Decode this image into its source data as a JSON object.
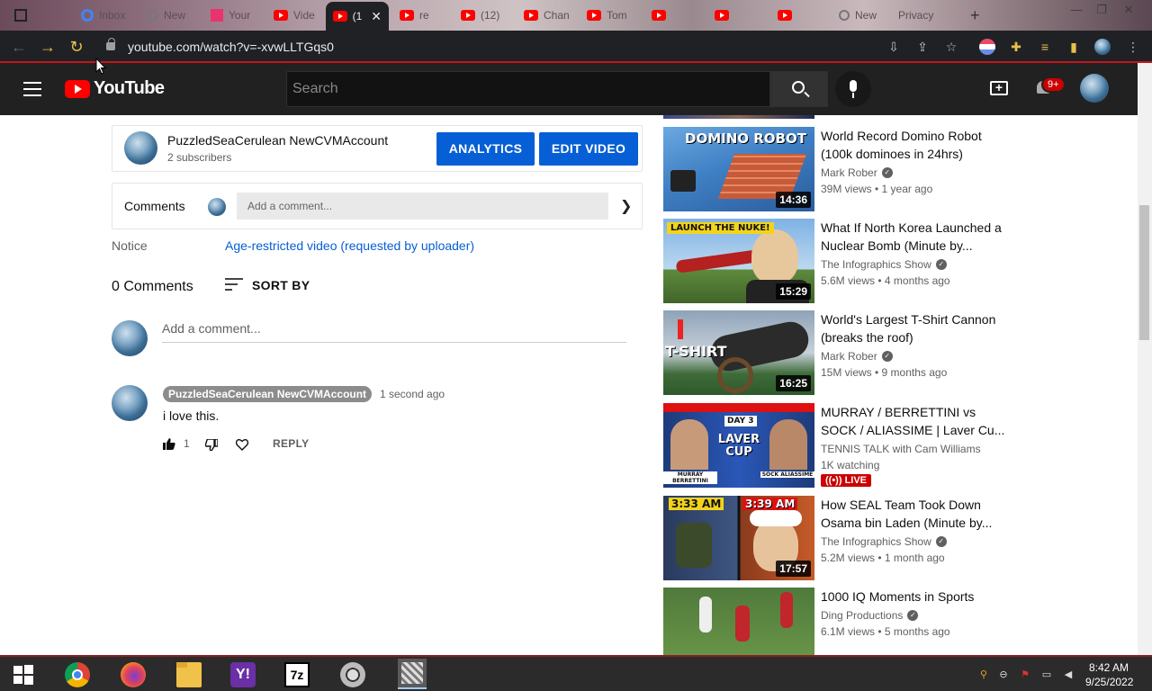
{
  "browser": {
    "url": "youtube.com/watch?v=-xvwLLTGqs0",
    "tabs": [
      {
        "label": "Inbox"
      },
      {
        "label": "New"
      },
      {
        "label": "Your"
      },
      {
        "label": "Vide"
      },
      {
        "label": "(1",
        "active": true
      },
      {
        "label": "re"
      },
      {
        "label": "(12)"
      },
      {
        "label": "Chan"
      },
      {
        "label": "Tom"
      },
      {
        "label": "New"
      },
      {
        "label": "Privacy"
      }
    ]
  },
  "header": {
    "logo_text": "YouTube",
    "search_placeholder": "Search",
    "notification_count": "9+"
  },
  "channel": {
    "name": "PuzzledSeaCerulean NewCVMAccount",
    "subscribers": "2 subscribers",
    "analytics_label": "ANALYTICS",
    "edit_label": "EDIT VIDEO"
  },
  "comments_panel": {
    "label": "Comments",
    "placeholder": "Add a comment..."
  },
  "notice": {
    "label": "Notice",
    "text": "Age-restricted video (requested by uploader)"
  },
  "comments": {
    "count_label": "0 Comments",
    "sort_label": "SORT BY",
    "add_placeholder": "Add a comment...",
    "items": [
      {
        "author": "PuzzledSeaCerulean NewCVMAccount",
        "time": "1 second ago",
        "text": "i love this.",
        "likes": "1",
        "reply_label": "REPLY"
      }
    ]
  },
  "recommendations": [
    {
      "title": "World Record Domino Robot (100k dominoes in 24hrs)",
      "channel": "Mark Rober",
      "meta": "39M views • 1 year ago",
      "duration": "14:36",
      "thumb_text": "DOMINO ROBOT",
      "verified": true
    },
    {
      "title": "What If North Korea Launched a Nuclear Bomb (Minute by...",
      "channel": "The Infographics Show",
      "meta": "5.6M views • 4 months ago",
      "duration": "15:29",
      "thumb_text": "LAUNCH THE NUKE!",
      "verified": true
    },
    {
      "title": "World's Largest T-Shirt Cannon (breaks the roof)",
      "channel": "Mark Rober",
      "meta": "15M views • 9 months ago",
      "duration": "16:25",
      "thumb_text": "T-SHIRT",
      "verified": true
    },
    {
      "title": "MURRAY / BERRETTINI vs SOCK / ALIASSIME | Laver Cu...",
      "channel": "TENNIS TALK with Cam Williams",
      "meta": "1K watching",
      "live_label": "LIVE",
      "thumb_text": "LAVER CUP",
      "thumb_day": "DAY 3",
      "thumb_left": "MURRAY BERRETTINI",
      "thumb_right": "SOCK ALIASSIME",
      "verified": false
    },
    {
      "title": "How SEAL Team Took Down Osama bin Laden (Minute by...",
      "channel": "The Infographics Show",
      "meta": "5.2M views • 1 month ago",
      "duration": "17:57",
      "thumb_text_left": "3:33 AM",
      "thumb_text_right": "3:39 AM",
      "verified": true
    },
    {
      "title": "1000 IQ Moments in Sports",
      "channel": "Ding Productions",
      "meta": "6.1M views • 5 months ago",
      "verified": true
    }
  ],
  "taskbar": {
    "time": "8:42 AM",
    "date": "9/25/2022"
  },
  "colors": {
    "accent_blue": "#065fd4",
    "youtube_red": "#ff0000",
    "header_bg": "#212121"
  }
}
